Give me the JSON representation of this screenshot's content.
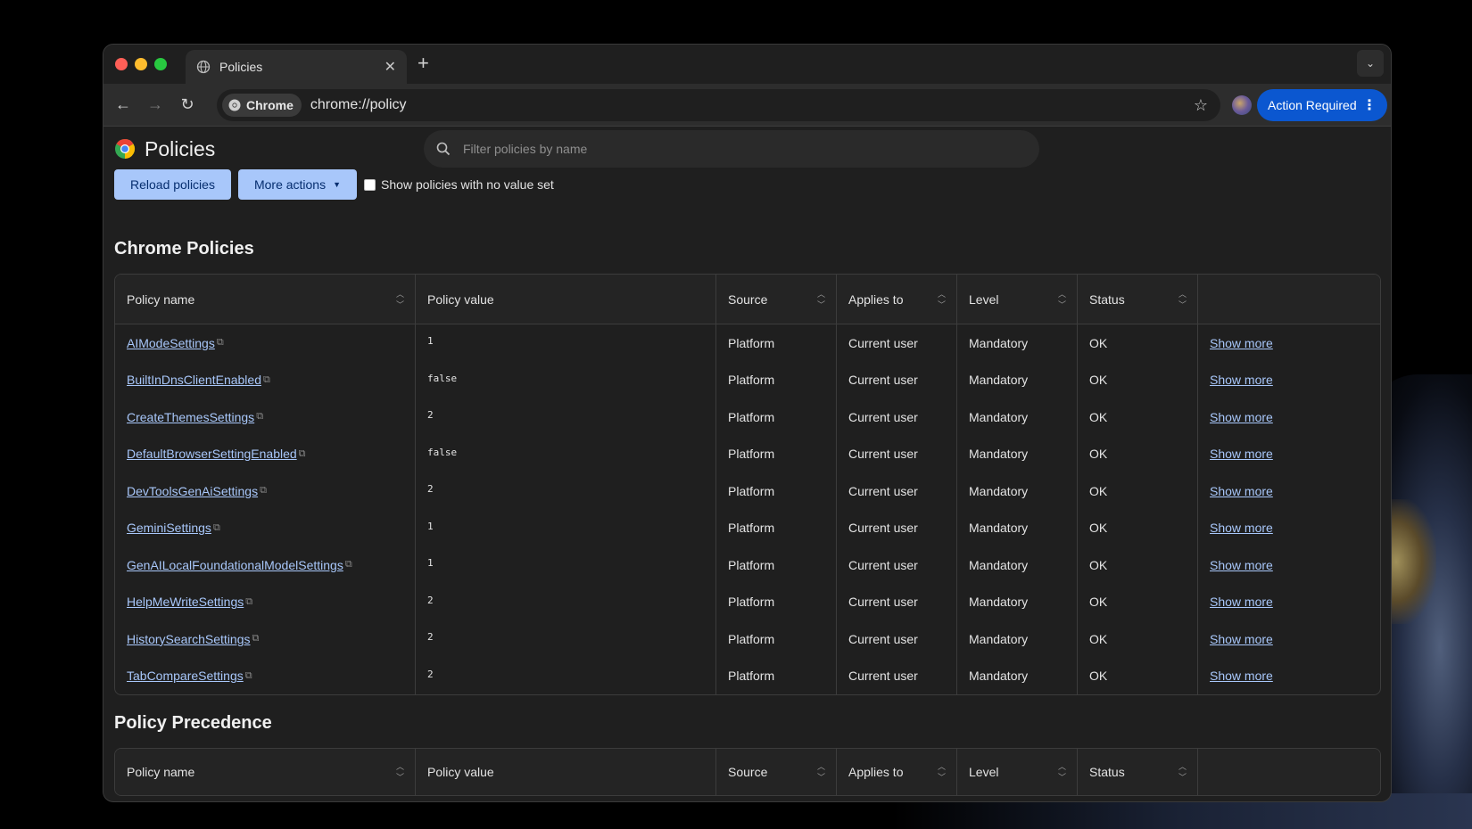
{
  "browser": {
    "tab_title": "Policies",
    "omnibox_chip": "Chrome",
    "url": "chrome://policy",
    "action_required": "Action Required"
  },
  "page": {
    "title": "Policies",
    "filter_placeholder": "Filter policies by name",
    "reload_label": "Reload policies",
    "more_actions_label": "More actions",
    "show_no_value_label": "Show policies with no value set"
  },
  "chrome_policies": {
    "title": "Chrome Policies",
    "headers": [
      "Policy name",
      "Policy value",
      "Source",
      "Applies to",
      "Level",
      "Status"
    ],
    "rows": [
      {
        "name": "AIModeSettings",
        "value": "1",
        "source": "Platform",
        "applies": "Current user",
        "level": "Mandatory",
        "status": "OK",
        "more": "Show more"
      },
      {
        "name": "BuiltInDnsClientEnabled",
        "value": "false",
        "source": "Platform",
        "applies": "Current user",
        "level": "Mandatory",
        "status": "OK",
        "more": "Show more"
      },
      {
        "name": "CreateThemesSettings",
        "value": "2",
        "source": "Platform",
        "applies": "Current user",
        "level": "Mandatory",
        "status": "OK",
        "more": "Show more"
      },
      {
        "name": "DefaultBrowserSettingEnabled",
        "value": "false",
        "source": "Platform",
        "applies": "Current user",
        "level": "Mandatory",
        "status": "OK",
        "more": "Show more"
      },
      {
        "name": "DevToolsGenAiSettings",
        "value": "2",
        "source": "Platform",
        "applies": "Current user",
        "level": "Mandatory",
        "status": "OK",
        "more": "Show more"
      },
      {
        "name": "GeminiSettings",
        "value": "1",
        "source": "Platform",
        "applies": "Current user",
        "level": "Mandatory",
        "status": "OK",
        "more": "Show more"
      },
      {
        "name": "GenAILocalFoundationalModelSettings",
        "value": "1",
        "source": "Platform",
        "applies": "Current user",
        "level": "Mandatory",
        "status": "OK",
        "more": "Show more"
      },
      {
        "name": "HelpMeWriteSettings",
        "value": "2",
        "source": "Platform",
        "applies": "Current user",
        "level": "Mandatory",
        "status": "OK",
        "more": "Show more"
      },
      {
        "name": "HistorySearchSettings",
        "value": "2",
        "source": "Platform",
        "applies": "Current user",
        "level": "Mandatory",
        "status": "OK",
        "more": "Show more"
      },
      {
        "name": "TabCompareSettings",
        "value": "2",
        "source": "Platform",
        "applies": "Current user",
        "level": "Mandatory",
        "status": "OK",
        "more": "Show more"
      }
    ]
  },
  "policy_precedence": {
    "title": "Policy Precedence",
    "headers": [
      "Policy name",
      "Policy value",
      "Source",
      "Applies to",
      "Level",
      "Status"
    ]
  },
  "colors": {
    "accent_button": "#a8c7fa",
    "action_required": "#0b57d0",
    "link": "#a8c7fa"
  }
}
